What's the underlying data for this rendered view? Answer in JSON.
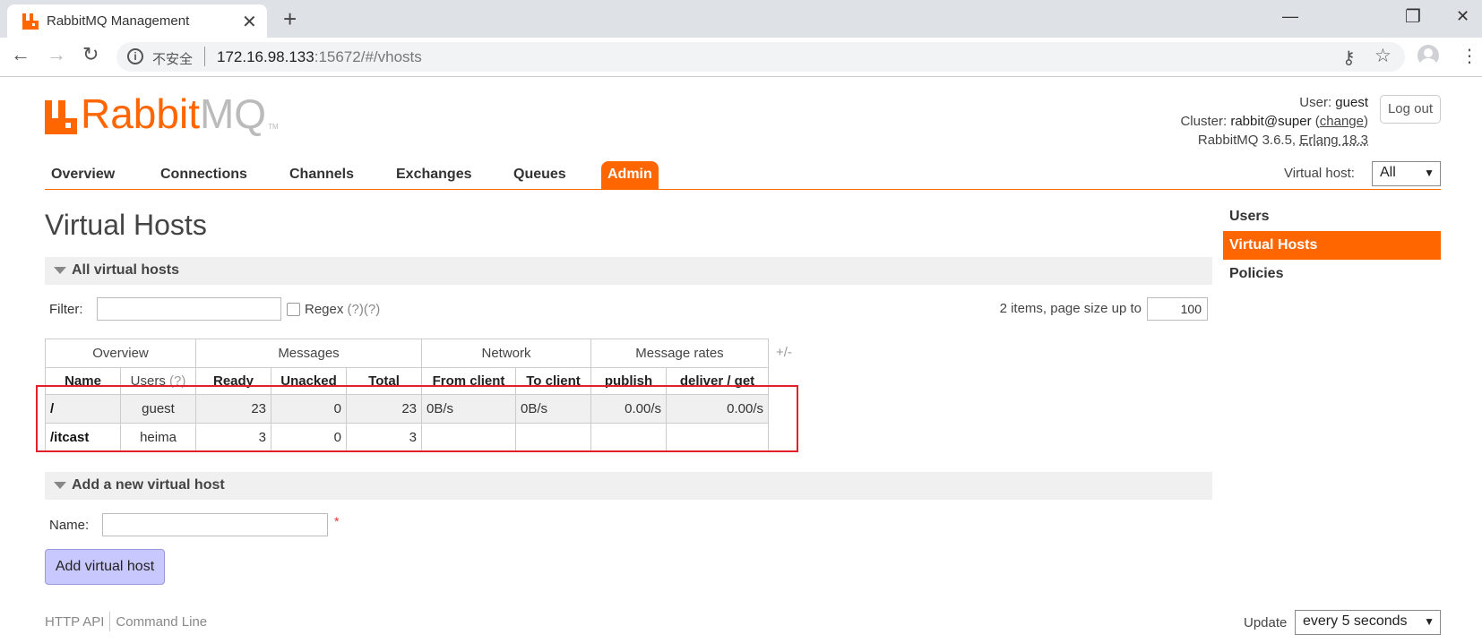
{
  "browser": {
    "tab_title": "RabbitMQ Management",
    "tab_close": "✕",
    "new_tab": "+",
    "minimize": "—",
    "restore": "❐",
    "close": "✕",
    "back": "←",
    "forward": "→",
    "reload": "↻",
    "security_label": "不安全",
    "url_host": "172.16.98.133",
    "url_rest": ":15672/#/vhosts",
    "key_icon": "⚷",
    "star_icon": "☆",
    "menu_icon": "⋮"
  },
  "header": {
    "logo_rabbit": "Rabbit",
    "logo_mq": "MQ",
    "logo_tm": "TM",
    "user_label": "User:",
    "user_value": "guest",
    "cluster_label": "Cluster:",
    "cluster_value": "rabbit@super",
    "change_link": "change",
    "version": "RabbitMQ 3.6.5,",
    "erlang": "Erlang 18.3",
    "logout": "Log out"
  },
  "nav": {
    "tabs": [
      {
        "label": "Overview"
      },
      {
        "label": "Connections"
      },
      {
        "label": "Channels"
      },
      {
        "label": "Exchanges"
      },
      {
        "label": "Queues"
      },
      {
        "label": "Admin",
        "active": true
      }
    ],
    "vhost_label": "Virtual host:",
    "vhost_value": "All"
  },
  "sidebar": {
    "items": [
      {
        "label": "Users"
      },
      {
        "label": "Virtual Hosts",
        "active": true
      },
      {
        "label": "Policies"
      }
    ]
  },
  "main": {
    "title": "Virtual Hosts",
    "all_section": "All virtual hosts",
    "filter_label": "Filter:",
    "filter_value": "",
    "regex_label": "Regex",
    "regex_help": "(?)(?)",
    "items_text": "2 items, page size up to",
    "page_size": "100",
    "table": {
      "groups": [
        "Overview",
        "Messages",
        "Network",
        "Message rates"
      ],
      "plusminus": "+/-",
      "columns": {
        "name": "Name",
        "users": "Users",
        "users_help": "(?)",
        "ready": "Ready",
        "unacked": "Unacked",
        "total": "Total",
        "from_client": "From client",
        "to_client": "To client",
        "publish": "publish",
        "deliver_get": "deliver / get"
      },
      "rows": [
        {
          "name": "/",
          "users": "guest",
          "ready": "23",
          "unacked": "0",
          "total": "23",
          "from_client": "0B/s",
          "to_client": "0B/s",
          "publish": "0.00/s",
          "deliver_get": "0.00/s"
        },
        {
          "name": "/itcast",
          "users": "heima",
          "ready": "3",
          "unacked": "0",
          "total": "3",
          "from_client": "",
          "to_client": "",
          "publish": "",
          "deliver_get": ""
        }
      ]
    },
    "add_section": "Add a new virtual host",
    "name_label": "Name:",
    "name_value": "",
    "required_mark": "*",
    "add_button": "Add virtual host"
  },
  "footer": {
    "http_api": "HTTP API",
    "command_line": "Command Line",
    "update_label": "Update",
    "update_value": "every 5 seconds"
  },
  "colors": {
    "brand": "#ff6600",
    "highlight_box": "#e0202a",
    "add_button_bg": "#c8c8ff"
  }
}
